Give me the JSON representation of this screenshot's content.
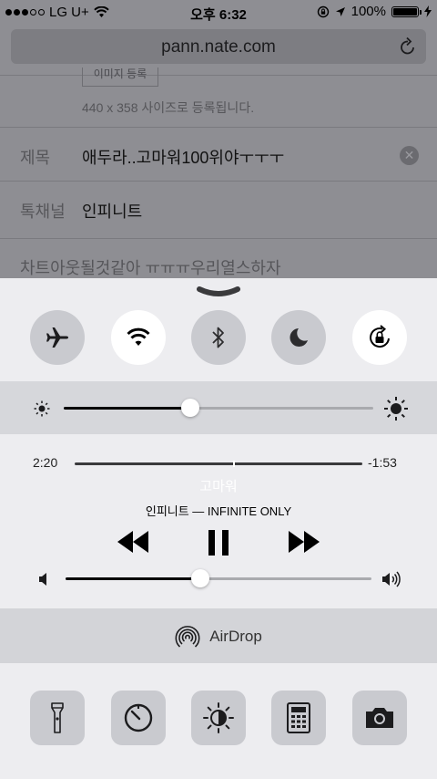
{
  "status_bar": {
    "carrier": "LG U+",
    "signal_dots_filled": 3,
    "signal_dots_total": 5,
    "time": "오후 6:32",
    "battery_percent": "100%",
    "battery_level": 1.0
  },
  "browser": {
    "url": "pann.nate.com"
  },
  "page": {
    "image_upload_button": "이미지 등록",
    "image_size_hint": "440 x 358 사이즈로 등록됩니다.",
    "title_label": "제목",
    "title_value": "애두라..고마워100위야ㅜㅜㅜ",
    "channel_label": "톡채널",
    "channel_value": "인피니트",
    "body_preview": "차트아웃될것같아 ㅠㅠㅠ우리열스하자"
  },
  "control_center": {
    "toggles": [
      {
        "name": "airplane-mode",
        "on": false
      },
      {
        "name": "wifi",
        "on": true
      },
      {
        "name": "bluetooth",
        "on": false
      },
      {
        "name": "do-not-disturb",
        "on": false
      },
      {
        "name": "rotation-lock",
        "on": true
      }
    ],
    "brightness_level": 0.41,
    "music": {
      "elapsed": "2:20",
      "remaining": "-1:53",
      "progress": 0.55,
      "title": "고마워",
      "artist_album": "인피니트 — INFINITE ONLY",
      "volume_level": 0.44
    },
    "airdrop_label": "AirDrop",
    "shortcuts": [
      "flashlight-icon",
      "timer-icon",
      "night-shift-icon",
      "calculator-icon",
      "camera-icon"
    ]
  }
}
